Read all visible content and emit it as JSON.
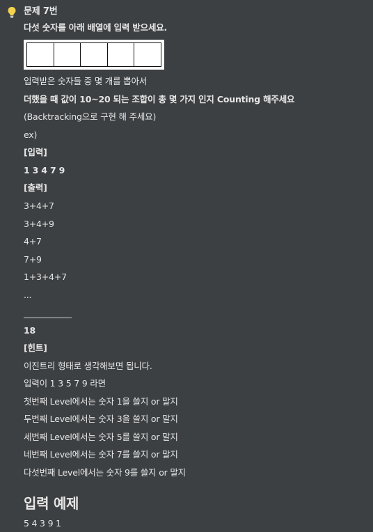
{
  "callout": {
    "icon": "lightbulb-icon",
    "title": "문제 7번",
    "lines": [
      "다섯 숫자를 아래 배열에 입력 받으세요.",
      "입력받은 숫자들 중 몇 개를 뽑아서",
      "더했을 때 값이 10~20 되는 조합이 총 몇 가지 인지 Counting 해주세요",
      "(Backtracking으로 구현 해 주세요)",
      "ex)",
      "[입력]",
      "1 3 4 7 9",
      "[출력]",
      "3+4+7",
      "3+4+9",
      "4+7",
      "7+9",
      "1+3+4+7",
      "...",
      "18",
      "[힌트]",
      "이진트리 형태로 생각해보면 됩니다.",
      "입력이 1 3 5 7 9 라면",
      "첫번째 Level에서는 숫자 1을 쓸지 or 말지",
      "두번째 Level에서는 숫자 3을 쓸지 or 말지",
      "세번째 Level에서는 숫자 5를 쓸지 or 말지",
      "네번째 Level에서는 숫자 7를 쓸지 or 말지",
      "다섯번째 Level에서는 숫자 9를 쓸지 or 말지"
    ],
    "array_cells": 5
  },
  "section": {
    "heading": "입력 예제",
    "example": "5 4 3 9 1"
  },
  "colors": {
    "background": "#3d4043",
    "text": "#e6e6e6",
    "icon": "#f3d24d"
  }
}
